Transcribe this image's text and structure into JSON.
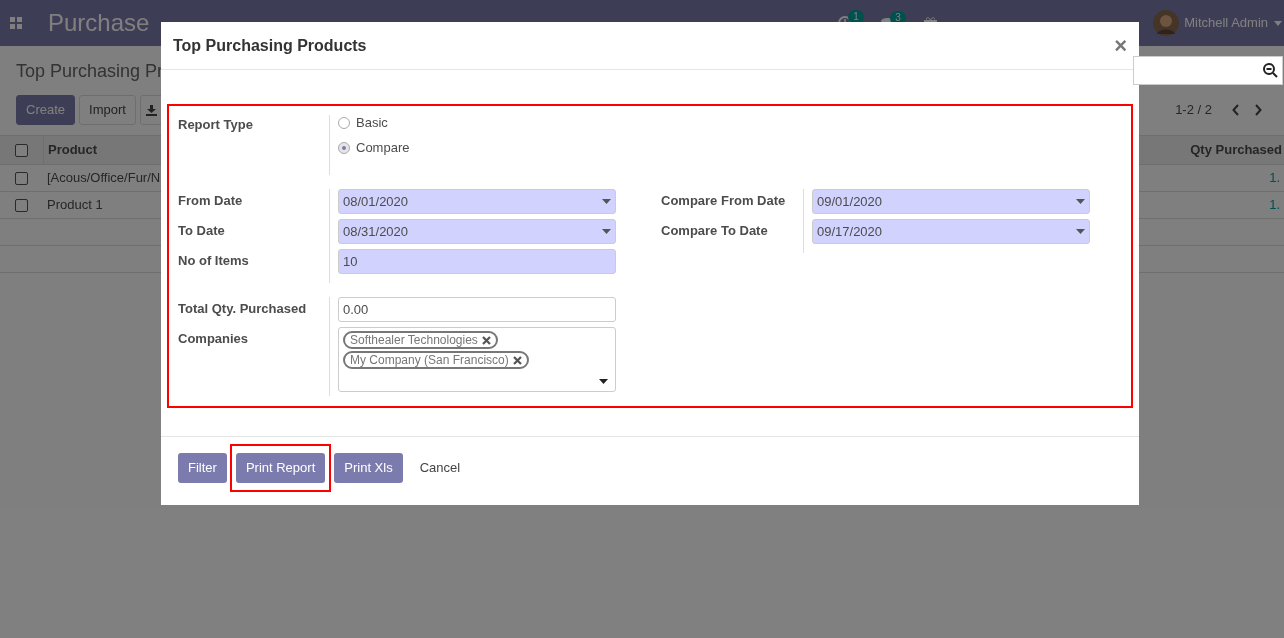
{
  "navbar": {
    "app_name": "Purchase",
    "activity_count": "1",
    "message_count": "3",
    "user": "Mitchell Admin"
  },
  "page": {
    "title": "Top Purchasing Pr",
    "buttons": [
      {
        "label": "Create",
        "kind": "primary"
      },
      {
        "label": "Import",
        "kind": "secondary"
      }
    ],
    "pager": "1-2 / 2"
  },
  "table": {
    "columns": [
      "Product",
      "Qty Purchased"
    ],
    "all_checked": false,
    "rows": [
      {
        "product": "[Acous/Office/Fur/N",
        "qty": "1.",
        "checked": false
      },
      {
        "product": "Product 1",
        "qty": "1.",
        "checked": false
      }
    ]
  },
  "dialog": {
    "title": "Top Purchasing Products",
    "close": "×",
    "highlighted": true,
    "report_type": {
      "label": "Report Type",
      "options": [
        {
          "label": "Basic",
          "selected": false
        },
        {
          "label": "Compare",
          "selected": true
        }
      ]
    },
    "left_fields": [
      {
        "label": "From Date",
        "value": "08/01/2020",
        "kind": "date",
        "required": true
      },
      {
        "label": "To Date",
        "value": "08/31/2020",
        "kind": "date",
        "required": true
      },
      {
        "label": "No of Items",
        "value": "10",
        "kind": "text",
        "required": true
      }
    ],
    "right_fields": [
      {
        "label": "Compare From Date",
        "value": "09/01/2020",
        "kind": "date",
        "required": true
      },
      {
        "label": "Compare To Date",
        "value": "09/17/2020",
        "kind": "date",
        "required": true
      }
    ],
    "extra_fields": [
      {
        "label": "Total Qty. Purchased",
        "value": "0.00",
        "kind": "text",
        "required": false
      },
      {
        "label": "Companies",
        "kind": "tags",
        "tags": [
          "Softhealer Technologies",
          "My Company (San Francisco)"
        ],
        "required": false
      }
    ],
    "buttons": [
      {
        "label": "Filter",
        "kind": "primary",
        "highlighted": false
      },
      {
        "label": "Print Report",
        "kind": "primary",
        "highlighted": true
      },
      {
        "label": "Print Xls",
        "kind": "primary",
        "highlighted": false
      },
      {
        "label": "Cancel",
        "kind": "link",
        "highlighted": false
      }
    ]
  }
}
